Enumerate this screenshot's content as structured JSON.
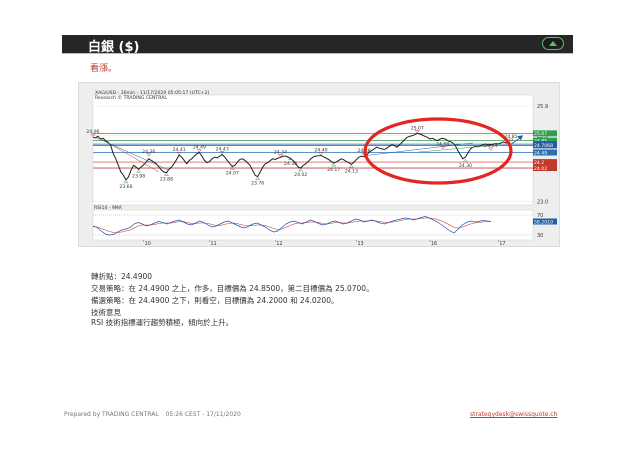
{
  "header": {
    "title": "白銀 ($)",
    "view": "看漲。"
  },
  "chart_info": {
    "line1": "XAG/USD - 30min - 11/17/2020 05:05:17 (UTC+2)",
    "line2": "Research © TRADING CENTRAL"
  },
  "chart_data": {
    "type": "line",
    "series": [
      {
        "values": [
          24.95,
          24.93,
          24.98,
          24.9,
          24.92,
          24.85,
          24.8,
          24.7,
          24.45,
          24.3,
          24.1,
          23.9,
          23.8,
          23.66,
          23.75,
          23.95,
          24.1,
          24.05,
          23.98,
          24.05,
          24.12,
          24.2,
          24.3,
          24.25,
          24.2,
          24.15,
          24.05,
          23.96,
          23.9,
          23.88,
          23.98,
          24.05,
          24.15,
          24.28,
          24.41,
          24.35,
          24.25,
          24.15,
          24.25,
          24.3,
          24.38,
          24.45,
          24.49,
          24.38,
          24.25,
          24.18,
          24.22,
          24.3,
          24.35,
          24.33,
          24.38,
          24.43,
          24.35,
          24.25,
          24.15,
          24.07,
          24.1,
          24.2,
          24.28,
          24.3,
          24.25,
          24.18,
          24.1,
          23.95,
          23.8,
          23.76,
          23.9,
          24.05,
          24.15,
          24.18,
          24.25,
          24.3,
          24.28,
          24.32,
          24.34,
          24.38,
          24.38,
          24.35,
          24.3,
          24.25,
          24.15,
          24.05,
          24.02,
          24.1,
          24.15,
          24.22,
          24.3,
          24.36,
          24.38,
          24.39,
          24.4,
          24.36,
          24.32,
          24.28,
          24.22,
          24.17,
          24.2,
          24.25,
          24.3,
          24.27,
          24.22,
          24.18,
          24.13,
          24.2,
          24.28,
          24.35,
          24.38,
          24.36,
          24.4,
          24.5,
          24.55,
          24.6,
          24.65,
          24.62,
          24.6,
          24.58,
          24.62,
          24.68,
          24.72,
          24.7,
          24.65,
          24.72,
          24.8,
          24.88,
          24.95,
          24.98,
          25.0,
          25.03,
          25.07,
          25.05,
          25.02,
          24.98,
          24.95,
          24.9,
          24.92,
          24.88,
          24.85,
          24.9,
          24.92,
          24.9,
          24.85,
          24.82,
          24.78,
          24.7,
          24.55,
          24.42,
          24.3,
          24.35,
          24.48,
          24.6,
          24.65,
          24.68,
          24.66,
          24.7,
          24.72,
          24.75,
          24.72,
          24.73,
          24.74,
          24.76,
          24.75,
          24.78,
          24.81,
          24.79,
          24.77,
          24.74
        ]
      }
    ],
    "levels": [
      {
        "value": 25.07,
        "label": "25.07",
        "color": "#2e9e4f"
      },
      {
        "value": 24.85,
        "label": "24.85",
        "color": "#2e9e4f"
      },
      {
        "value": 24.7448,
        "label": "24.7448",
        "color": "#1f5fa8"
      },
      {
        "value": 24.7068,
        "label": "24.7068",
        "color": "#1f5fa8"
      },
      {
        "value": 24.49,
        "label": "24.49",
        "color": "#2a6fb0"
      },
      {
        "value": 24.2,
        "label": "24.2",
        "color": "#c0392b"
      },
      {
        "value": 24.02,
        "label": "24.02",
        "color": "#c0392b"
      }
    ],
    "point_labels": [
      {
        "i": 0,
        "value": 24.96,
        "label": "24.96"
      },
      {
        "i": 13,
        "value": 23.66,
        "label": "23.66"
      },
      {
        "i": 18,
        "value": 23.98,
        "label": "23.98"
      },
      {
        "i": 22,
        "value": 24.36,
        "label": "24.36"
      },
      {
        "i": 29,
        "value": 23.88,
        "label": "23.88"
      },
      {
        "i": 34,
        "value": 24.41,
        "label": "24.41"
      },
      {
        "i": 42,
        "value": 24.49,
        "label": "24.49"
      },
      {
        "i": 51,
        "value": 24.43,
        "label": "24.43"
      },
      {
        "i": 55,
        "value": 24.07,
        "label": "24.07"
      },
      {
        "i": 65,
        "value": 23.76,
        "label": "23.76"
      },
      {
        "i": 74,
        "value": 24.34,
        "label": "24.34"
      },
      {
        "i": 78,
        "value": 24.36,
        "label": "24.36"
      },
      {
        "i": 82,
        "value": 24.02,
        "label": "24.02"
      },
      {
        "i": 90,
        "value": 24.4,
        "label": "24.40"
      },
      {
        "i": 95,
        "value": 24.17,
        "label": "24.17"
      },
      {
        "i": 102,
        "value": 24.13,
        "label": "24.13"
      },
      {
        "i": 107,
        "value": 24.38,
        "label": "24.38"
      },
      {
        "i": 128,
        "value": 25.07,
        "label": "25.07"
      },
      {
        "i": 138,
        "value": 24.58,
        "label": "24.58"
      },
      {
        "i": 147,
        "value": 24.3,
        "label": "24.30"
      },
      {
        "i": 157,
        "value": 24.54,
        "label": "24.54"
      },
      {
        "i": 165,
        "value": 24.81,
        "label": "24.81"
      }
    ],
    "ylim": [
      22.9,
      26.05
    ],
    "yticks": [
      25.9,
      25.0,
      24.0,
      23.0
    ],
    "ytick_labels": [
      "25.9",
      "25.0",
      "24.0",
      "23.0"
    ],
    "xtick_labels": [
      "10",
      "11",
      "12",
      "13",
      "16",
      "17"
    ],
    "xtick_index": [
      20,
      46,
      72,
      104,
      133,
      160
    ],
    "rsi": {
      "title": "RSI14 - 9MA",
      "ylim": [
        20,
        80
      ],
      "yticks": [
        70,
        30
      ],
      "ytick_labels": [
        "70",
        "30"
      ],
      "current_value": "58.2010",
      "values": [
        48,
        45,
        38,
        32,
        30,
        31,
        36,
        40,
        42,
        45,
        52,
        55,
        52,
        48,
        50,
        54,
        57,
        55,
        52,
        55,
        58,
        60,
        56,
        52,
        50,
        54,
        58,
        55,
        50,
        46,
        48,
        52,
        56,
        58,
        54,
        50,
        46,
        44,
        48,
        52,
        54,
        50,
        46,
        40,
        36,
        38,
        45,
        52,
        56,
        58,
        55,
        52,
        56,
        60,
        57,
        53,
        50,
        52,
        56,
        58,
        55,
        52,
        54,
        58,
        62,
        60,
        56,
        58,
        60,
        57,
        54,
        52,
        55,
        58,
        60,
        62,
        64,
        63,
        60,
        62,
        65,
        67,
        64,
        60,
        56,
        50,
        44,
        38,
        34,
        42,
        50,
        55,
        58,
        56,
        57,
        59,
        58,
        57
      ],
      "ma": [
        47,
        46,
        43,
        40,
        37,
        35,
        35,
        36,
        38,
        40,
        44,
        48,
        50,
        50,
        50,
        51,
        53,
        54,
        54,
        54,
        55,
        57,
        57,
        55,
        53,
        53,
        54,
        54,
        53,
        51,
        49,
        49,
        51,
        53,
        54,
        53,
        51,
        49,
        48,
        49,
        50,
        50,
        49,
        46,
        43,
        41,
        42,
        45,
        49,
        52,
        54,
        54,
        55,
        56,
        56,
        55,
        53,
        52,
        53,
        55,
        55,
        54,
        54,
        55,
        57,
        58,
        58,
        58,
        59,
        58,
        57,
        55,
        55,
        56,
        57,
        59,
        61,
        62,
        62,
        62,
        63,
        64,
        64,
        63,
        61,
        58,
        54,
        50,
        45,
        44,
        46,
        49,
        52,
        54,
        55,
        56,
        57,
        57
      ]
    },
    "highlight": "circle"
  },
  "text": {
    "pivot": "轉折點：24.4900",
    "strategy": "交易策略：在 24.4900 之上，作多，目標價為 24.8500，第二目標價為 25.0700。",
    "alternative": "備選策略：在 24.4900 之下，則看空，目標價為  24.2000 和 24.0200。",
    "comment_title": "技術意見",
    "comment": "RSI 技術指標運行趨勢積極，傾向於上升。"
  },
  "footer": {
    "prepared": "Prepared by TRADING CENTRAL",
    "time": "05:26 CEST - 17/11/2020",
    "email": "strategydesk@swissquote.ch"
  },
  "colors": {
    "price_line": "#1f1f1f",
    "rsi_line": "#2b4fb5",
    "rsi_ma": "#c0392b",
    "circle": "#e3261f",
    "title_bar": "#262626"
  }
}
